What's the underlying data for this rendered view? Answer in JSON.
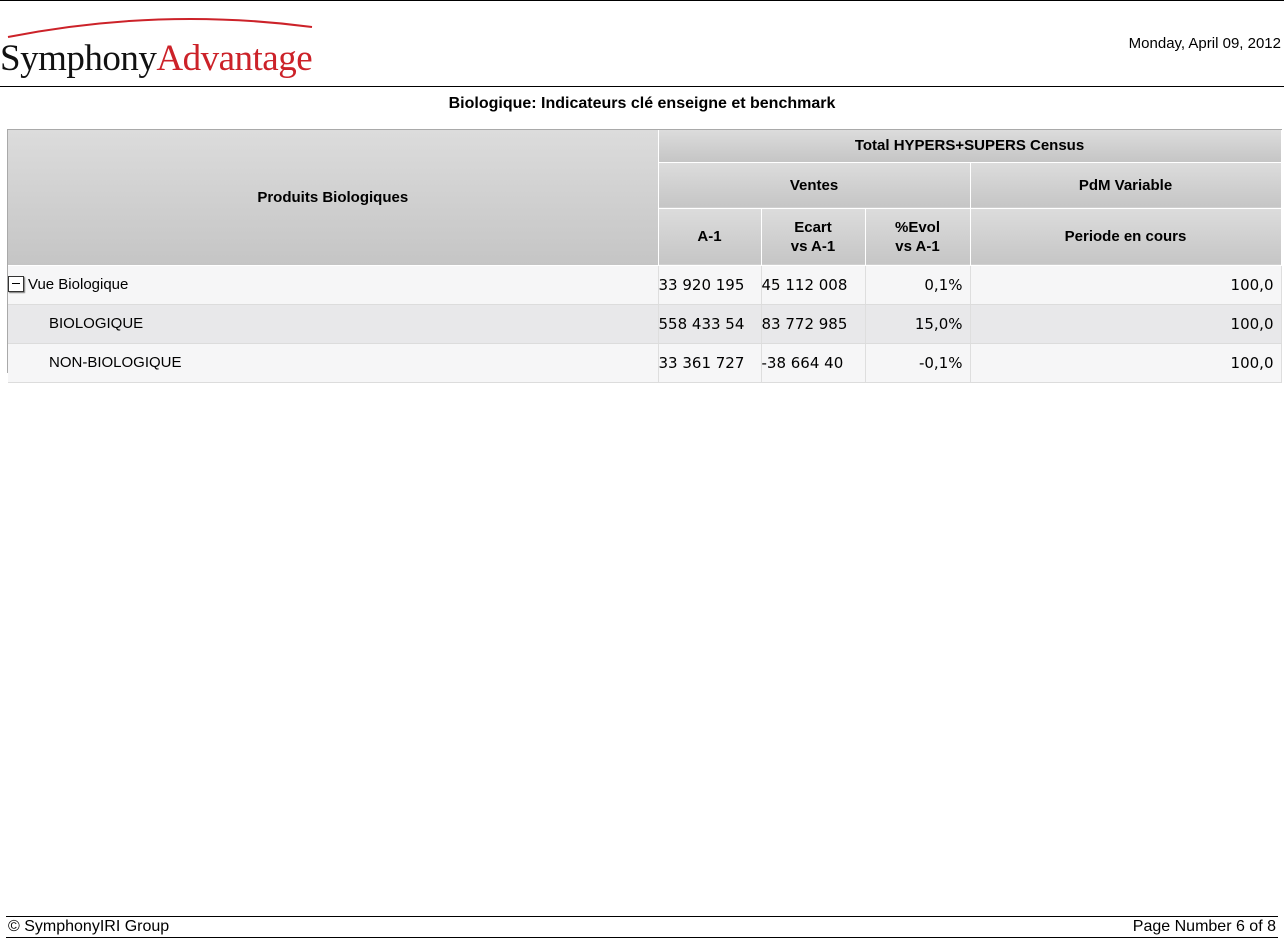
{
  "header": {
    "logo": {
      "part1": "Symphony",
      "part2": "Advantage"
    },
    "date": "Monday, April 09, 2012"
  },
  "report": {
    "title": "Biologique: Indicateurs clé enseigne et benchmark"
  },
  "table": {
    "row_header": "Produits Biologiques",
    "group_header": "Total HYPERS+SUPERS Census",
    "ventes_header": "Ventes",
    "pdm_header": "PdM Variable",
    "columns": {
      "a1": "A-1",
      "ecart_line1": "Ecart",
      "ecart_line2": "vs A-1",
      "evol_line1": "%Evol",
      "evol_line2": "vs A-1",
      "periode": "Periode en cours"
    },
    "rows": [
      {
        "label": "Vue Biologique",
        "a1": "33 920 195",
        "ecart": "45 112 008",
        "evol": "0,1%",
        "pdm": "100,0"
      },
      {
        "label": "BIOLOGIQUE",
        "a1": "558 433 54",
        "ecart": "83 772 985",
        "evol": "15,0%",
        "pdm": "100,0"
      },
      {
        "label": "NON-BIOLOGIQUE",
        "a1": "33 361 727",
        "ecart": "-38 664 40",
        "evol": "-0,1%",
        "pdm": "100,0"
      }
    ]
  },
  "footer": {
    "copyright": "© SymphonyIRI Group",
    "page": "Page Number 6 of 8"
  },
  "colors": {
    "brand_red": "#cc2229",
    "header_gray": "#d0d0d0"
  },
  "icons": {
    "collapse": "minus-box-icon"
  }
}
